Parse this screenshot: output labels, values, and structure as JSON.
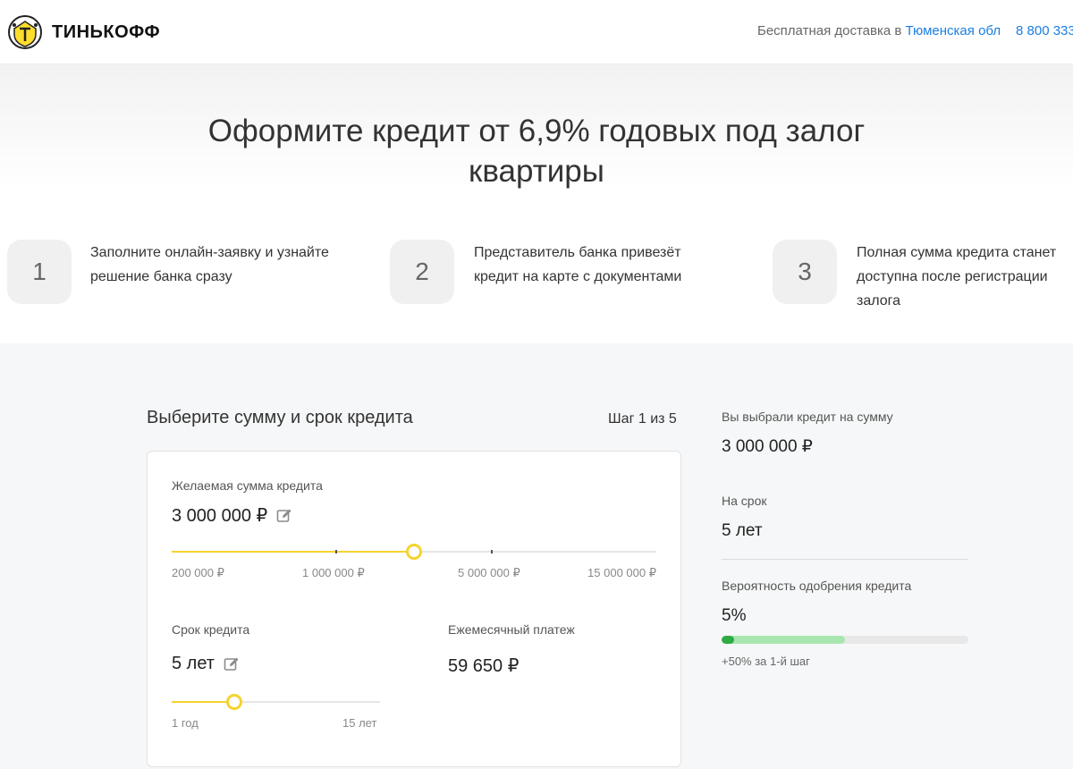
{
  "header": {
    "logo_text": "ТИНЬКОФФ",
    "delivery_prefix": "Бесплатная доставка в",
    "delivery_region": "Тюменская обл",
    "phone": "8 800 333"
  },
  "hero": {
    "title": "Оформите кредит от 6,9% годовых под залог квартиры",
    "steps": [
      {
        "number": "1",
        "text": "Заполните онлайн-заявку и узнайте решение банка сразу"
      },
      {
        "number": "2",
        "text": "Представитель банка привезёт кредит на карте с документами"
      },
      {
        "number": "3",
        "text": "Полная сумма кредита станет доступна после регистрации залога"
      }
    ]
  },
  "calculator": {
    "title": "Выберите сумму и срок кредита",
    "step_indicator": "Шаг 1 из 5",
    "amount": {
      "label": "Желаемая сумма кредита",
      "value": "3 000 000 ₽",
      "slider_fraction": 0.5,
      "ticks": [
        "200 000 ₽",
        "1 000 000 ₽",
        "5 000 000 ₽",
        "15 000 000 ₽"
      ]
    },
    "term": {
      "label": "Срок кредита",
      "value": "5 лет",
      "slider_fraction": 0.3,
      "min_label": "1 год",
      "max_label": "15 лет"
    },
    "payment": {
      "label": "Ежемесячный платеж",
      "value": "59 650 ₽"
    }
  },
  "summary": {
    "amount_label": "Вы выбрали кредит на сумму",
    "amount_value": "3 000 000 ₽",
    "term_label": "На срок",
    "term_value": "5 лет",
    "probability_label": "Вероятность одобрения кредита",
    "probability_value": "5%",
    "probability_percent": 5,
    "bonus_percent": 50,
    "bonus_note": "+50% за 1-й шаг"
  },
  "colors": {
    "accent_yellow": "#f5d330",
    "link_blue": "#1a7ee0",
    "success_green": "#2dab45",
    "bonus_green": "#a8e6b0"
  }
}
